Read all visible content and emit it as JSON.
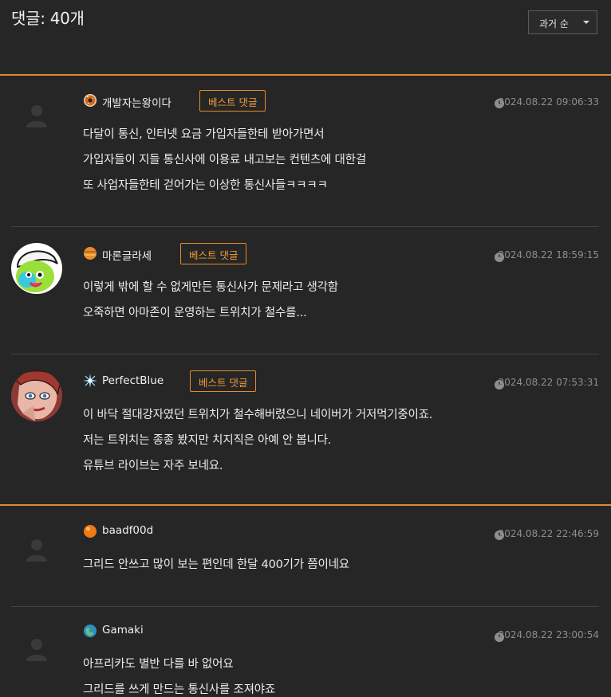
{
  "header": {
    "title": "댓글: 40개",
    "sort_label": "과거 순"
  },
  "badge_label": "베스트 댓글",
  "colors": {
    "background": "#262626",
    "accent_orange": "#e08a2c",
    "date_gray": "#8e8e8e"
  },
  "comments": [
    {
      "nickname": "개발자는왕이다",
      "nick_icon": "donut-icon",
      "best": true,
      "date": "2024.08.22 09:06:33",
      "avatar": "default-avatar",
      "lines": [
        "다달이 통신, 인터넷 요금 가입자들한테 받아가면서",
        "가입자들이 지들 통신사에 이용료 내고보는 컨텐츠에 대한걸",
        "또 사업자들한테 걷어가는 이상한 통신사들ㅋㅋㅋㅋ"
      ]
    },
    {
      "nickname": "마론글라세",
      "nick_icon": "planet-icon",
      "best": true,
      "date": "2024.08.22 18:59:15",
      "avatar": "parrot-avatar",
      "lines": [
        "이렇게 밖에 할 수 없게만든 통신사가 문제라고 생각함",
        "오죽하면 아마존이 운영하는 트위치가 철수를..."
      ]
    },
    {
      "nickname": "PerfectBlue",
      "nick_icon": "sparkle-icon",
      "best": true,
      "date": "2024.08.22 07:53:31",
      "avatar": "comic-face-avatar",
      "lines": [
        "이 바닥 절대강자였던 트위치가 철수해버렸으니 네이버가 거저먹기중이죠.",
        "저는 트위치는 종종 봤지만 치지직은 아예 안 봅니다.",
        "유튜브 라이브는 자주 보네요."
      ]
    },
    {
      "nickname": "baadf00d",
      "nick_icon": "orange-ball-icon",
      "best": false,
      "date": "2024.08.22 22:46:59",
      "avatar": "default-avatar",
      "lines": [
        "그리드 안쓰고 많이 보는 편인데 한달 400기가 쯤이네요"
      ]
    },
    {
      "nickname": "Gamaki",
      "nick_icon": "globe-icon",
      "best": false,
      "date": "2024.08.22 23:00:54",
      "avatar": "default-avatar",
      "lines": [
        "아프리카도 별반 다를 바 없어요",
        "그리드를 쓰게 만드는 통신사를 조져야죠"
      ]
    }
  ]
}
